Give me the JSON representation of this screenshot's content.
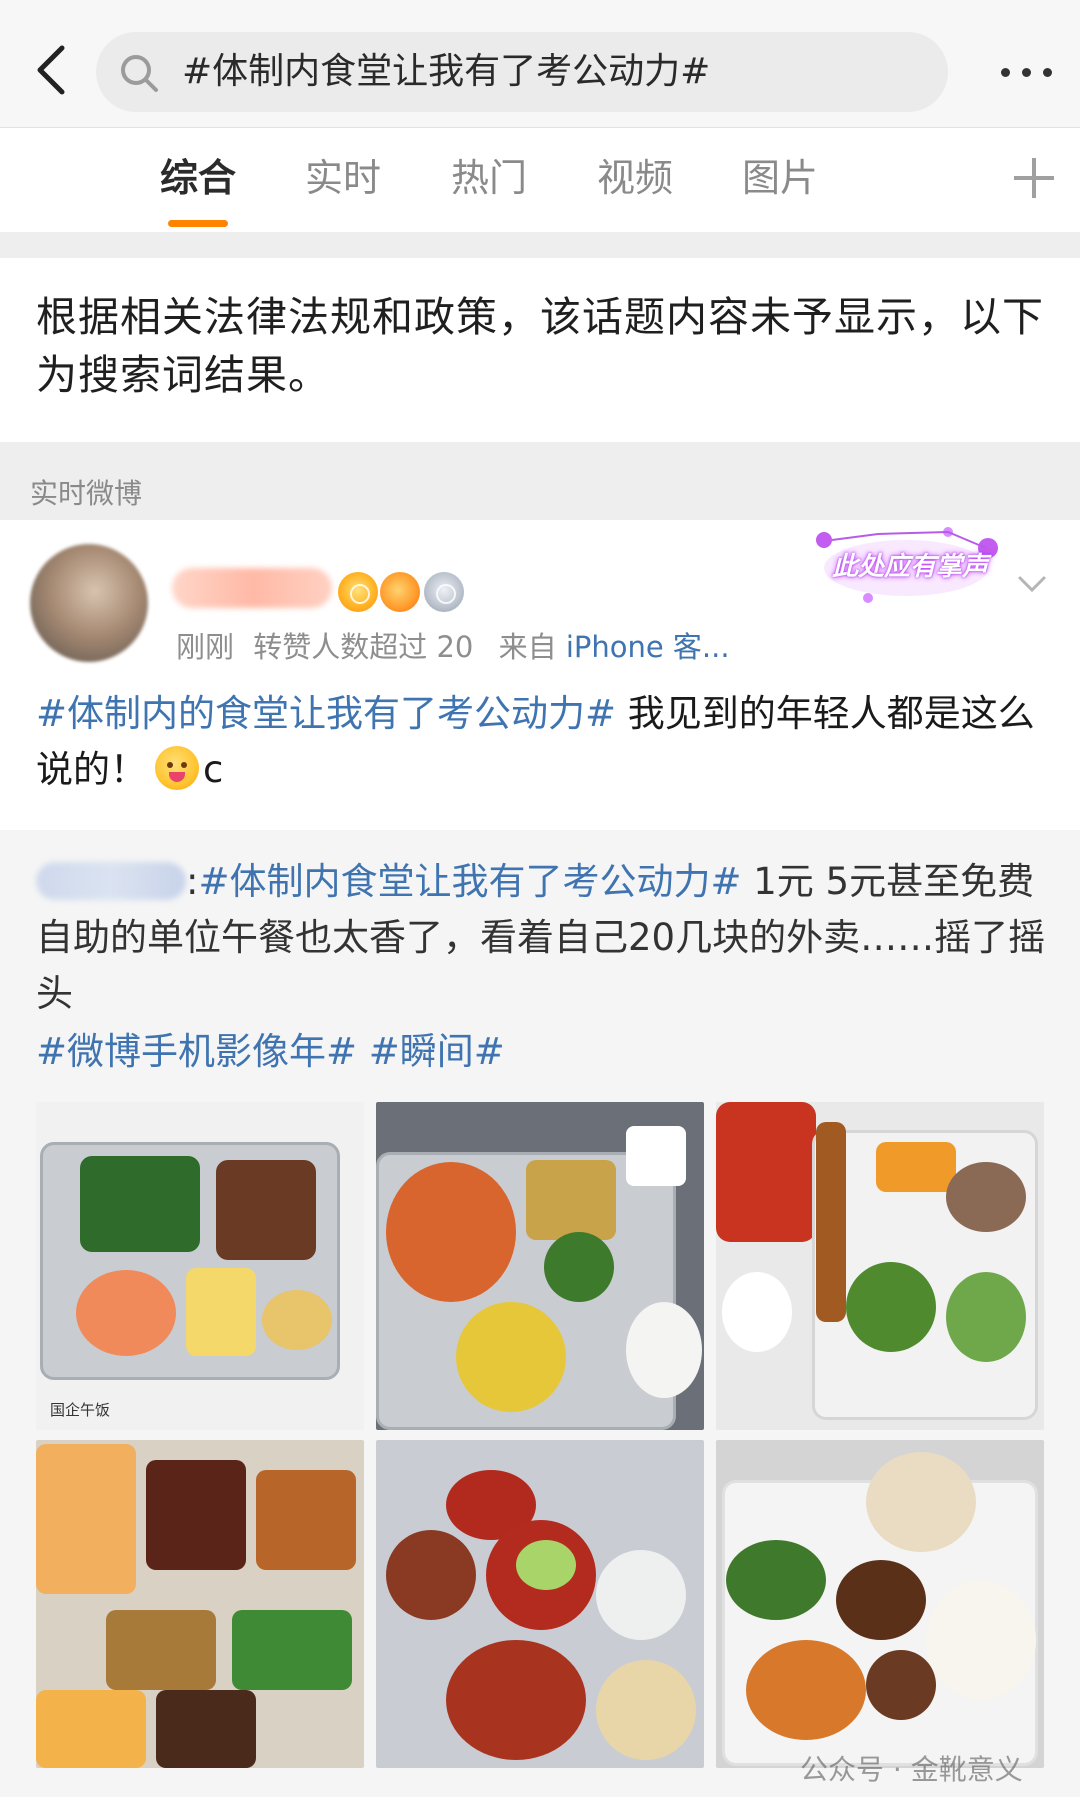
{
  "search": {
    "query": "#体制内食堂让我有了考公动力#"
  },
  "tabs": [
    {
      "label": "综合",
      "active": true
    },
    {
      "label": "实时",
      "active": false
    },
    {
      "label": "热门",
      "active": false
    },
    {
      "label": "视频",
      "active": false
    },
    {
      "label": "图片",
      "active": false
    }
  ],
  "notice": {
    "text": "根据相关法律法规和政策，该话题内容未予显示，以下为搜索词结果。"
  },
  "section": {
    "label": "实时微博"
  },
  "post": {
    "time": "刚刚",
    "reposts": "转赞人数超过 20",
    "source_prefix": "来自",
    "source": "iPhone 客...",
    "sticker": "此处应有掌声",
    "topic": "#体制内的食堂让我有了考公动力#",
    "text": " 我见到的年轻人都是这么说的！",
    "text_tail": "c",
    "icons": {
      "crown": "crown-badge-icon",
      "fish": "fish-badge-icon",
      "medal": "medal-badge-icon",
      "emoji": "yummy-face-emoji-icon"
    }
  },
  "repost": {
    "topic": "#体制内食堂让我有了考公动力#",
    "text": " 1元 5元甚至免费自助的单位午餐也太香了，看着自己20几块的外卖……摇了摇头",
    "topic_tags": "#微博手机影像年# #瞬间#",
    "photos": [
      {
        "caption": "国企午饭"
      },
      {
        "caption": ""
      },
      {
        "caption": ""
      },
      {
        "caption": ""
      },
      {
        "caption": ""
      },
      {
        "caption": ""
      }
    ]
  },
  "watermark": {
    "text": "公众号 · 金靴意义"
  },
  "colors": {
    "accent": "#ff8200",
    "link": "#3f74b0"
  }
}
